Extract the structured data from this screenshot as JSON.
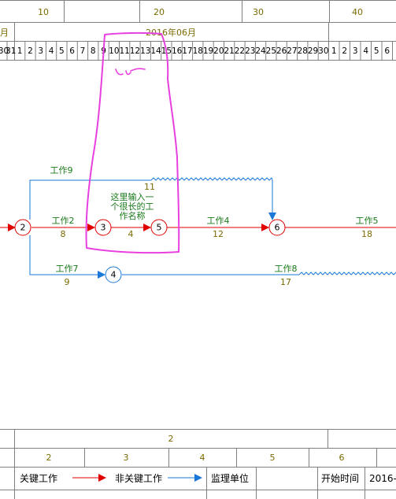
{
  "ruler": {
    "top_numbers": [
      "10",
      "20",
      "30",
      "40"
    ],
    "month_left": "月",
    "month_label": "2016年06月",
    "days_left": [
      "30",
      "31"
    ],
    "days": [
      "1",
      "2",
      "3",
      "4",
      "5",
      "6",
      "7",
      "8",
      "9",
      "10",
      "11",
      "12",
      "13",
      "14",
      "15",
      "16",
      "17",
      "18",
      "19",
      "20",
      "21",
      "22",
      "23",
      "24",
      "25",
      "26",
      "27",
      "28",
      "29",
      "30"
    ],
    "days_right": [
      "1",
      "2",
      "3",
      "4",
      "5",
      "6"
    ]
  },
  "colors": {
    "critical": "#e00000",
    "noncritical": "#1a78d8",
    "label_green": "#1a7a1a",
    "grid": "#808080",
    "annotation": "#e840e0"
  },
  "nodes": [
    {
      "id": "2",
      "type": "critical"
    },
    {
      "id": "3",
      "type": "critical"
    },
    {
      "id": "5",
      "type": "critical"
    },
    {
      "id": "6",
      "type": "critical"
    },
    {
      "id": "4",
      "type": "noncritical"
    }
  ],
  "activities": [
    {
      "name": "工作9",
      "duration": "11",
      "from": "2",
      "to": "6",
      "critical": false
    },
    {
      "name": "工作2",
      "duration": "8",
      "from": "2",
      "to": "3",
      "critical": true
    },
    {
      "name": "这里输入一个很长的工作名称",
      "name_lines": [
        "这里输入一",
        "个很长的工",
        "作名称"
      ],
      "duration": "4",
      "from": "3",
      "to": "5",
      "critical": true
    },
    {
      "name": "工作4",
      "duration": "12",
      "from": "5",
      "to": "6",
      "critical": true
    },
    {
      "name": "工作5",
      "duration": "18",
      "from": "6",
      "to": "",
      "critical": true
    },
    {
      "name": "工作7",
      "duration": "9",
      "from": "2",
      "to": "4",
      "critical": false
    },
    {
      "name": "工作8",
      "duration": "17",
      "from": "4",
      "to": "",
      "critical": false
    }
  ],
  "bottom_scale": {
    "row1": [
      "2"
    ],
    "row2": [
      "2",
      "3",
      "4",
      "5",
      "6"
    ]
  },
  "legend": {
    "critical_label": "关键工作",
    "noncritical_label": "非关键工作",
    "supervisor_label": "监理单位",
    "start_time_label": "开始时间",
    "start_time_value": "2016-"
  }
}
